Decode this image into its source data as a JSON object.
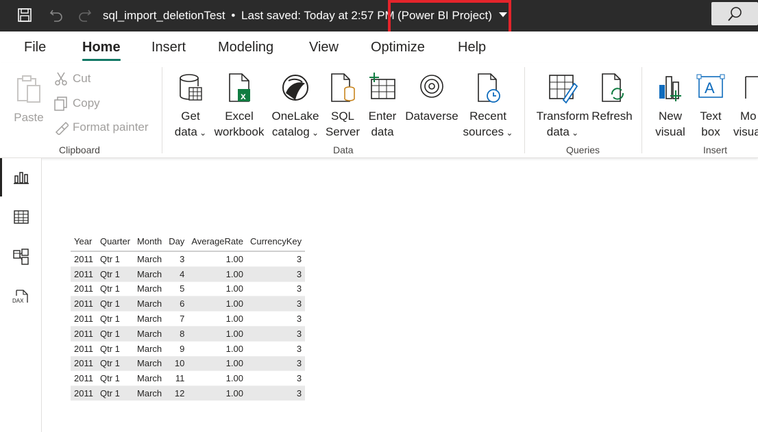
{
  "titlebar": {
    "file_name": "sql_import_deletionTest",
    "separator": "•",
    "saved_status": "Last saved: Today at 2:57 PM",
    "project_label": "(Power BI Project)"
  },
  "menu": {
    "items": [
      "File",
      "Home",
      "Insert",
      "Modeling",
      "View",
      "Optimize",
      "Help"
    ],
    "active": "Home"
  },
  "ribbon": {
    "clipboard": {
      "paste": "Paste",
      "cut": "Cut",
      "copy": "Copy",
      "format_painter": "Format painter",
      "group_label": "Clipboard"
    },
    "data": {
      "get_data": [
        "Get",
        "data"
      ],
      "excel": [
        "Excel",
        "workbook"
      ],
      "onelake": [
        "OneLake",
        "catalog"
      ],
      "sql": [
        "SQL",
        "Server"
      ],
      "enter_data": [
        "Enter",
        "data"
      ],
      "dataverse": "Dataverse",
      "recent": [
        "Recent",
        "sources"
      ],
      "group_label": "Data"
    },
    "queries": {
      "transform": [
        "Transform",
        "data"
      ],
      "refresh": "Refresh",
      "group_label": "Queries"
    },
    "insert": {
      "new_visual": [
        "New",
        "visual"
      ],
      "text_box": [
        "Text",
        "box"
      ],
      "more_visuals": [
        "Mo",
        "visua"
      ],
      "group_label": "Insert"
    }
  },
  "table": {
    "columns": [
      "Year",
      "Quarter",
      "Month",
      "Day",
      "AverageRate",
      "CurrencyKey"
    ],
    "rows": [
      [
        "2011",
        "Qtr 1",
        "March",
        "3",
        "1.00",
        "3"
      ],
      [
        "2011",
        "Qtr 1",
        "March",
        "4",
        "1.00",
        "3"
      ],
      [
        "2011",
        "Qtr 1",
        "March",
        "5",
        "1.00",
        "3"
      ],
      [
        "2011",
        "Qtr 1",
        "March",
        "6",
        "1.00",
        "3"
      ],
      [
        "2011",
        "Qtr 1",
        "March",
        "7",
        "1.00",
        "3"
      ],
      [
        "2011",
        "Qtr 1",
        "March",
        "8",
        "1.00",
        "3"
      ],
      [
        "2011",
        "Qtr 1",
        "March",
        "9",
        "1.00",
        "3"
      ],
      [
        "2011",
        "Qtr 1",
        "March",
        "10",
        "1.00",
        "3"
      ],
      [
        "2011",
        "Qtr 1",
        "March",
        "11",
        "1.00",
        "3"
      ],
      [
        "2011",
        "Qtr 1",
        "March",
        "12",
        "1.00",
        "3"
      ]
    ]
  },
  "leftrail": {
    "icons": [
      "report-view-icon",
      "table-view-icon",
      "model-view-icon",
      "dax-query-view-icon"
    ],
    "dax_label": "DAX"
  },
  "colors": {
    "titlebar_bg": "#2b2b2b",
    "accent": "#117865",
    "highlight": "#e3242b"
  }
}
